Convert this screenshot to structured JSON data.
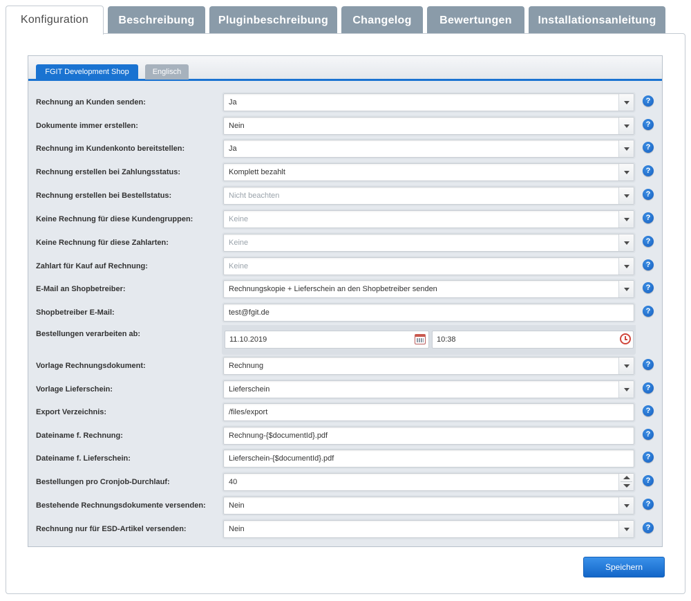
{
  "top_tabs": [
    {
      "label": "Konfiguration",
      "active": true
    },
    {
      "label": "Beschreibung",
      "active": false
    },
    {
      "label": "Pluginbeschreibung",
      "active": false
    },
    {
      "label": "Changelog",
      "active": false
    },
    {
      "label": "Bewertungen",
      "active": false
    },
    {
      "label": "Installationsanleitung",
      "active": false
    }
  ],
  "shop_tabs": [
    {
      "label": "FGIT Development Shop",
      "active": true
    },
    {
      "label": "Englisch",
      "active": false
    }
  ],
  "fields": [
    {
      "label": "Rechnung an Kunden senden:",
      "value": "Ja",
      "type": "select"
    },
    {
      "label": "Dokumente immer erstellen:",
      "value": "Nein",
      "type": "select"
    },
    {
      "label": "Rechnung im Kundenkonto bereitstellen:",
      "value": "Ja",
      "type": "select"
    },
    {
      "label": "Rechnung erstellen bei Zahlungsstatus:",
      "value": "Komplett bezahlt",
      "type": "select"
    },
    {
      "label": "Rechnung erstellen bei Bestellstatus:",
      "value": "Nicht beachten",
      "type": "select",
      "placeholder": true
    },
    {
      "label": "Keine Rechnung für diese Kundengruppen:",
      "value": "Keine",
      "type": "select",
      "placeholder": true
    },
    {
      "label": "Keine Rechnung für diese Zahlarten:",
      "value": "Keine",
      "type": "select",
      "placeholder": true
    },
    {
      "label": "Zahlart für Kauf auf Rechnung:",
      "value": "Keine",
      "type": "select",
      "placeholder": true
    },
    {
      "label": "E-Mail an Shopbetreiber:",
      "value": "Rechnungskopie + Lieferschein an den Shopbetreiber senden",
      "type": "select"
    },
    {
      "label": "Shopbetreiber E-Mail:",
      "value": "test@fgit.de",
      "type": "text"
    },
    {
      "label": "Bestellungen verarbeiten ab:",
      "date": "11.10.2019",
      "time": "10:38",
      "type": "datetime"
    },
    {
      "label": "Vorlage Rechnungsdokument:",
      "value": "Rechnung",
      "type": "select"
    },
    {
      "label": "Vorlage Lieferschein:",
      "value": "Lieferschein",
      "type": "select"
    },
    {
      "label": "Export Verzeichnis:",
      "value": "/files/export",
      "type": "text"
    },
    {
      "label": "Dateiname f. Rechnung:",
      "value": "Rechnung-{$documentId}.pdf",
      "type": "text"
    },
    {
      "label": "Dateiname f. Lieferschein:",
      "value": "Lieferschein-{$documentId}.pdf",
      "type": "text"
    },
    {
      "label": "Bestellungen pro Cronjob-Durchlauf:",
      "value": "40",
      "type": "number"
    },
    {
      "label": "Bestehende Rechnungsdokumente versenden:",
      "value": "Nein",
      "type": "select"
    },
    {
      "label": "Rechnung nur für ESD-Artikel versenden:",
      "value": "Nein",
      "type": "select"
    }
  ],
  "help_glyph": "?",
  "save_label": "Speichern",
  "colors": {
    "accent": "#1a73d1",
    "tab_inactive": "#8a9ba9",
    "panel_bg": "#e5e9ee"
  }
}
